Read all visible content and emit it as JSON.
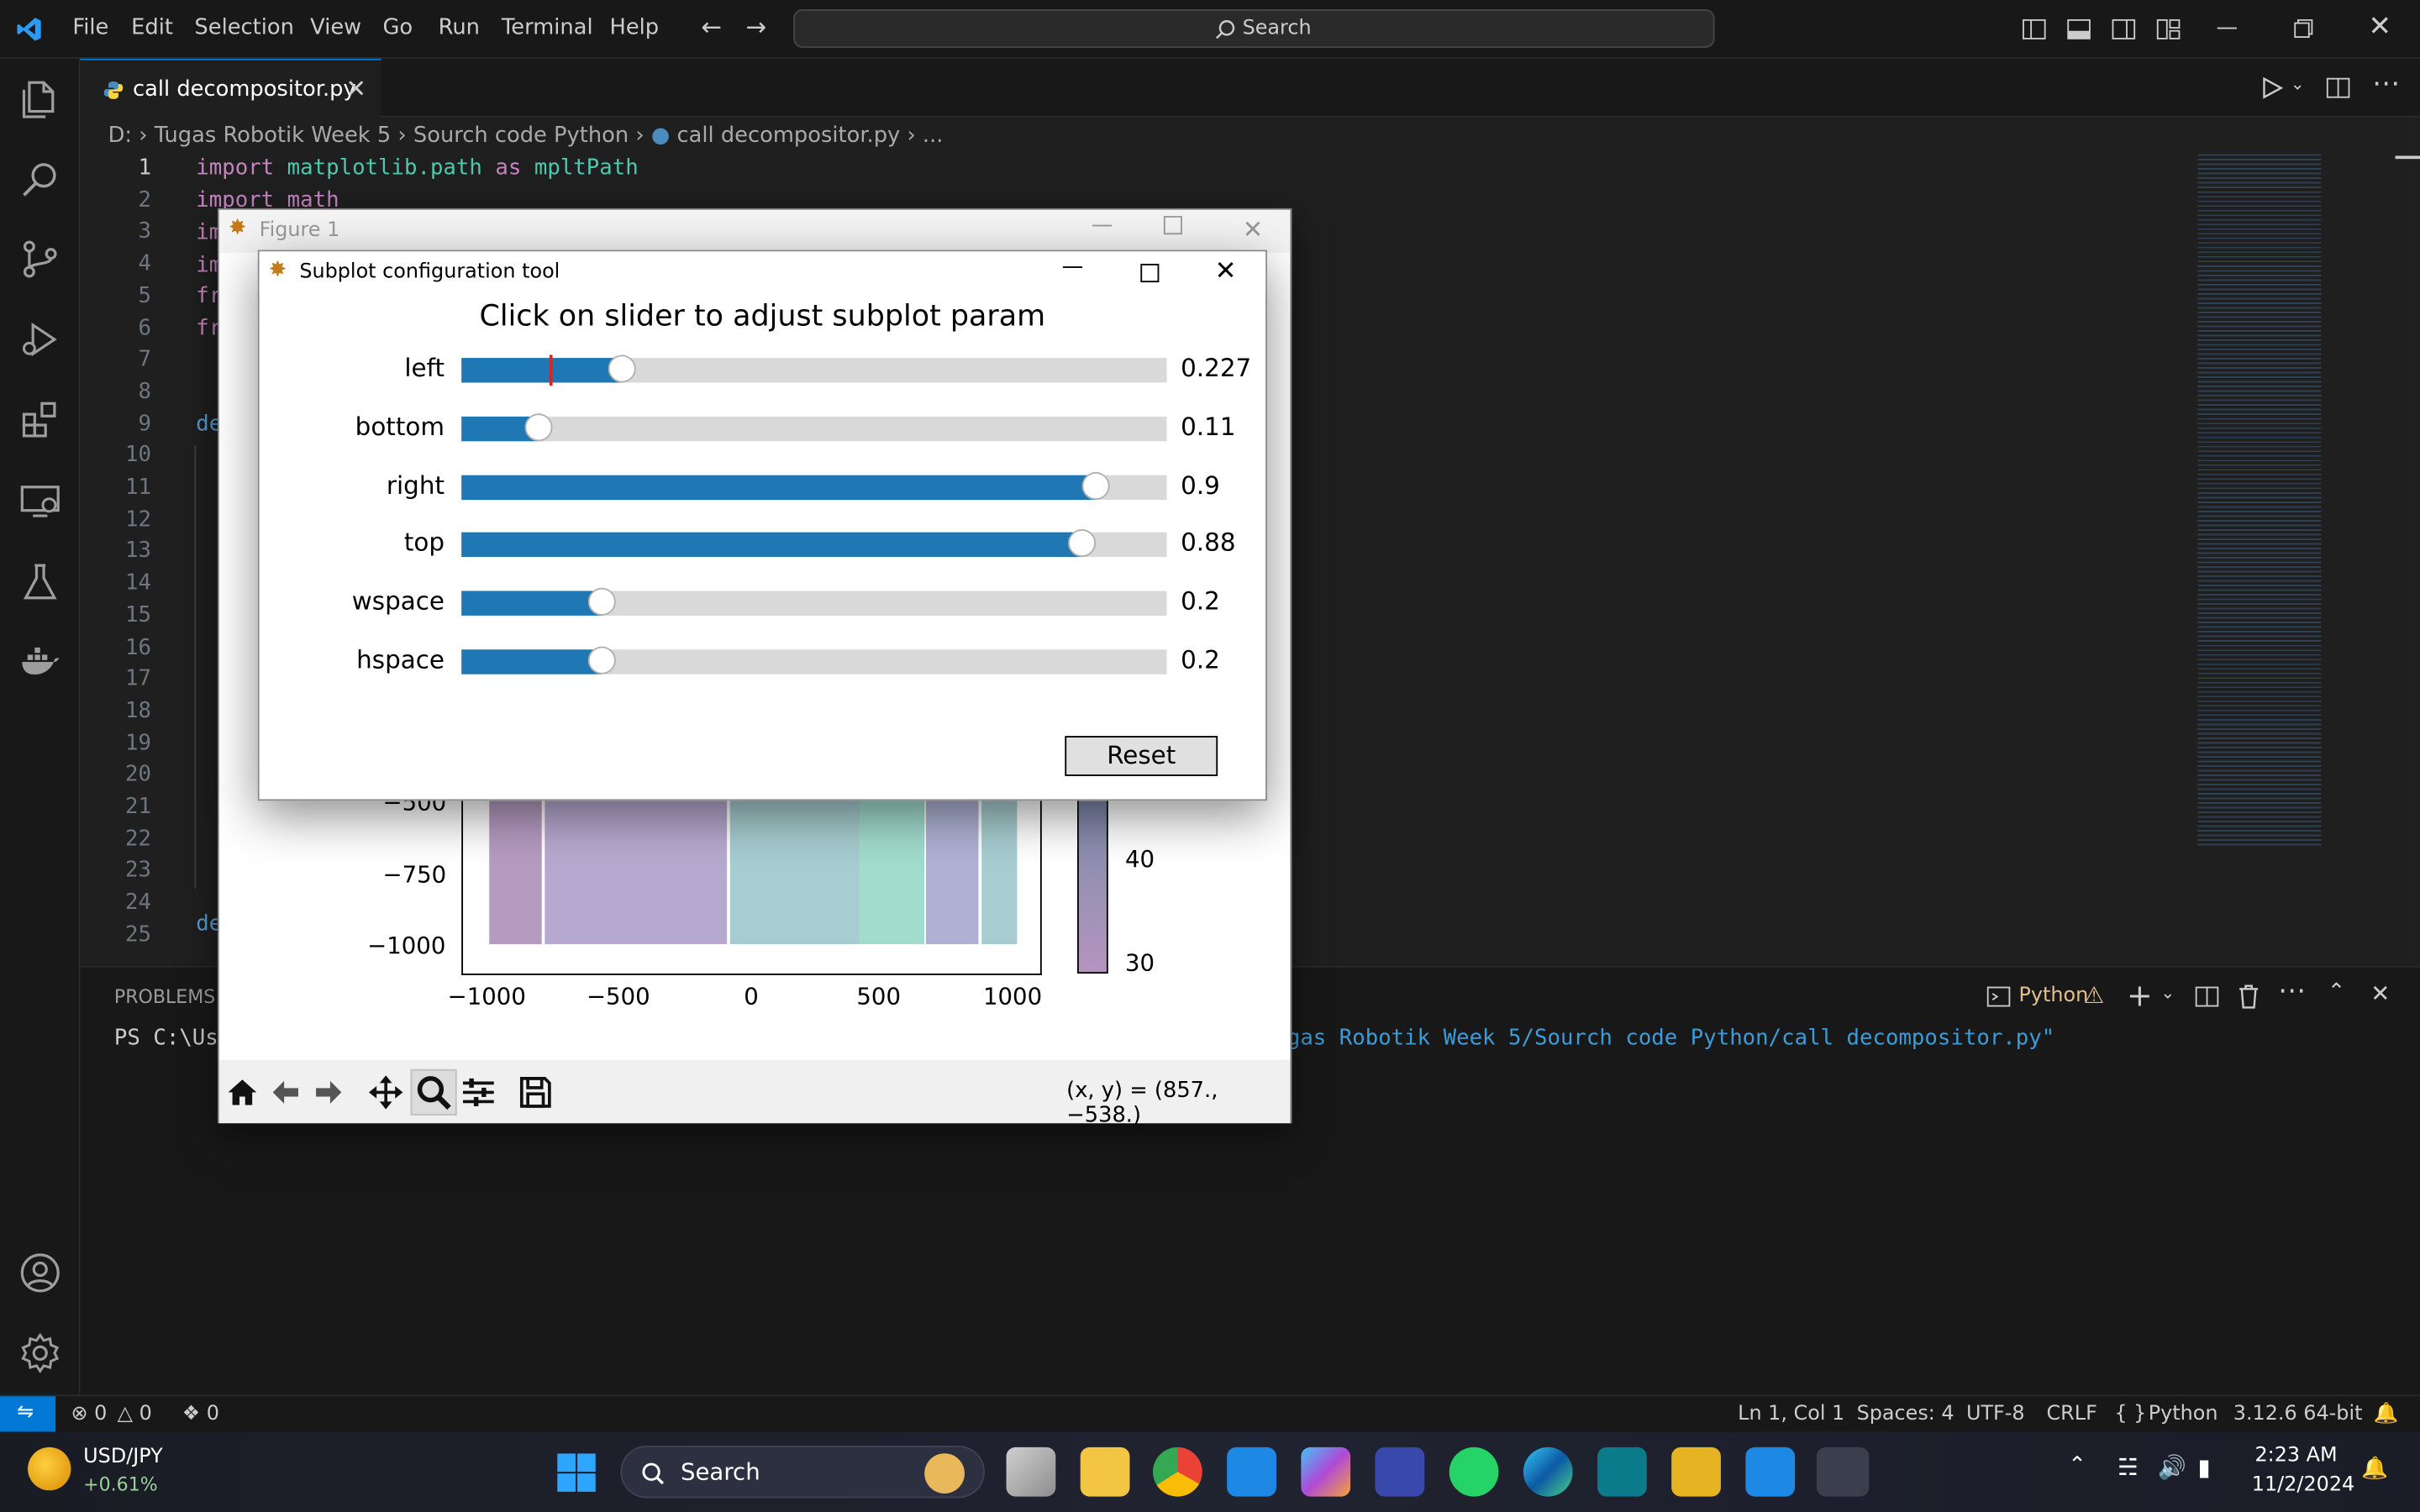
{
  "menu": [
    "File",
    "Edit",
    "Selection",
    "View",
    "Go",
    "Run",
    "Terminal",
    "Help"
  ],
  "command_center": {
    "placeholder": "Search"
  },
  "tab": {
    "label": "call decompositor.py"
  },
  "breadcrumb": [
    "D:",
    "Tugas Robotik Week 5",
    "Sourch code Python",
    "call decompositor.py",
    "..."
  ],
  "editor": {
    "line_numbers": [
      "1",
      "2",
      "3",
      "4",
      "5",
      "6",
      "7",
      "8",
      "9",
      "10",
      "11",
      "12",
      "13",
      "14",
      "15",
      "16",
      "17",
      "18",
      "19",
      "20",
      "21",
      "22",
      "23",
      "24",
      "25"
    ],
    "line1_kw1": "import",
    "line1_mod": "matplotlib.path",
    "line1_kw2": "as",
    "line1_alias": "mpltPath",
    "line2": "import math",
    "frag_im": "im",
    "frag_fr": "fr",
    "frag_de": "de"
  },
  "panel": {
    "tab_problems": "PROBLEMS",
    "prompt": "PS C:\\Us",
    "cmd_tail": "gas Robotik Week 5/Sourch code Python/call decompositor.py\"",
    "shell_label": "Python"
  },
  "status": {
    "errors": "0",
    "warnings": "0",
    "ports": "0",
    "position": "Ln 1, Col 1",
    "spaces": "Spaces: 4",
    "encoding": "UTF-8",
    "eol": "CRLF",
    "language": "Python",
    "interpreter": "3.12.6 64-bit"
  },
  "figure": {
    "title": "Figure 1",
    "coords": "(x, y) = (857., −538.)",
    "y_ticks": [
      "−500",
      "−750",
      "−1000"
    ],
    "x_ticks": [
      "−1000",
      "−500",
      "0",
      "500",
      "1000"
    ],
    "cbar_ticks": [
      "40",
      "30"
    ]
  },
  "dialog": {
    "title": "Subplot configuration tool",
    "heading": "Click on slider to adjust subplot param",
    "reset": "Reset",
    "sliders": [
      {
        "label": "left",
        "value": 0.227,
        "text": "0.227"
      },
      {
        "label": "bottom",
        "value": 0.11,
        "text": "0.11"
      },
      {
        "label": "right",
        "value": 0.9,
        "text": "0.9"
      },
      {
        "label": "top",
        "value": 0.88,
        "text": "0.88"
      },
      {
        "label": "wspace",
        "value": 0.2,
        "text": "0.2"
      },
      {
        "label": "hspace",
        "value": 0.2,
        "text": "0.2"
      }
    ]
  },
  "taskbar": {
    "ticker": "USD/JPY",
    "change": "+0.61%",
    "search": "Search",
    "time": "2:23 AM",
    "date": "11/2/2024"
  },
  "colors": {
    "accent": "#0078d4",
    "slider_fill": "#1f77b4",
    "slider_track": "#d9d9d9",
    "keyword": "#c586c0",
    "module": "#4ec9b0"
  }
}
